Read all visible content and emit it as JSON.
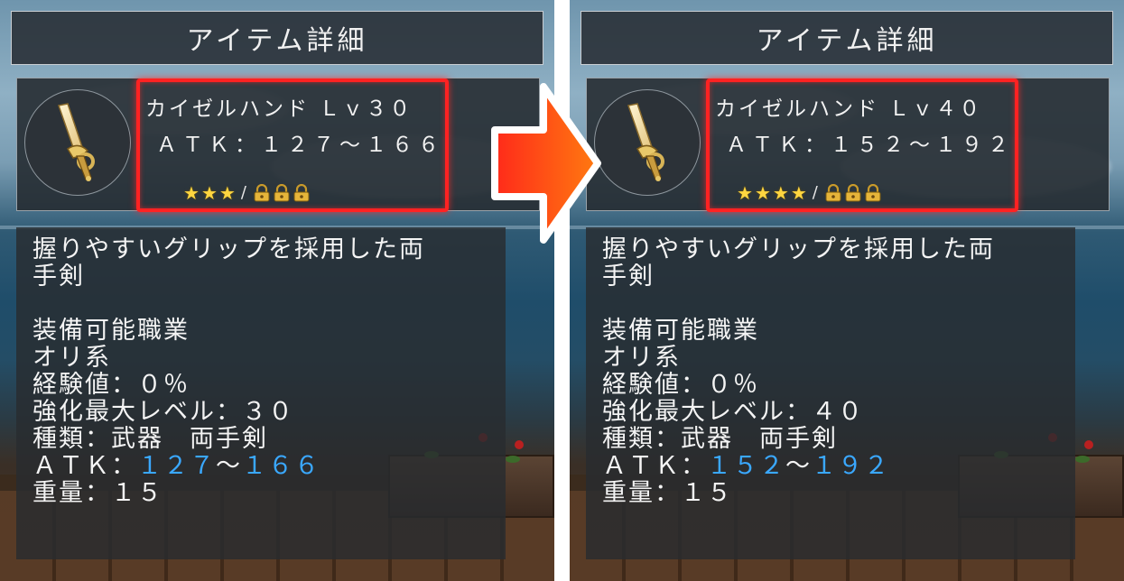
{
  "panels": [
    {
      "title": "アイテム詳細",
      "item_name": "カイゼルハンド Ｌｖ３０",
      "item_atk": "ＡＴＫ：１２７～１６６",
      "stars_filled": 3,
      "locks": 3,
      "description": {
        "line1": "握りやすいグリップを採用した両",
        "line2": "手剣",
        "jobs_header": "装備可能職業",
        "jobs_value": "オリ系",
        "exp": "経験値：０％",
        "max_level": "強化最大レベル：３０",
        "type": "種類：武器　両手剣",
        "atk_label": "ＡＴＫ：",
        "atk_min": "１２７",
        "atk_sep": "～",
        "atk_max": "１６６",
        "weight": "重量：１５"
      }
    },
    {
      "title": "アイテム詳細",
      "item_name": "カイゼルハンド Ｌｖ４０",
      "item_atk": "ＡＴＫ：１５２～１９２",
      "stars_filled": 4,
      "locks": 3,
      "description": {
        "line1": "握りやすいグリップを採用した両",
        "line2": "手剣",
        "jobs_header": "装備可能職業",
        "jobs_value": "オリ系",
        "exp": "経験値：０％",
        "max_level": "強化最大レベル：４０",
        "type": "種類：武器　両手剣",
        "atk_label": "ＡＴＫ：",
        "atk_min": "１５２",
        "atk_sep": "～",
        "atk_max": "１９２",
        "weight": "重量：１５"
      }
    }
  ],
  "rating_separator": "/",
  "colors": {
    "highlight": "#ff2222",
    "atk_value": "#3aa8ff",
    "star": "#ffd640",
    "arrow": "#ff5a1a"
  },
  "icons": {
    "item": "sword-icon",
    "star": "star-icon",
    "lock": "lock-icon",
    "arrow": "arrow-right-icon"
  }
}
